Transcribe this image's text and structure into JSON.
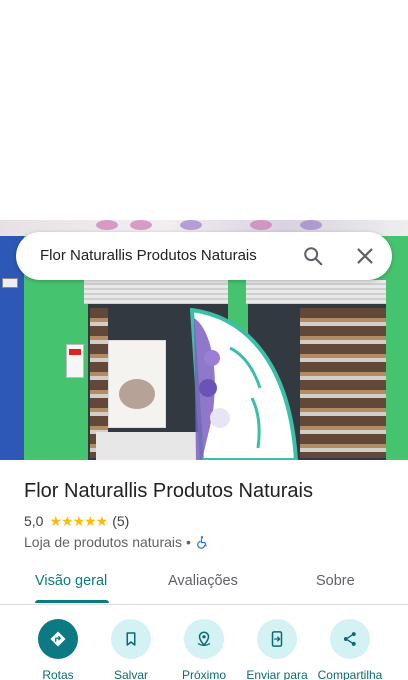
{
  "search": {
    "query": "Flor Naturallis Produtos Naturais"
  },
  "place": {
    "name": "Flor Naturallis Produtos Naturais",
    "rating": "5,0",
    "stars": "★★★★★",
    "review_count": "(5)",
    "category": "Loja de produtos naturais",
    "separator": "•"
  },
  "tabs": [
    {
      "label": "Visão geral",
      "active": true
    },
    {
      "label": "Avaliações",
      "active": false
    },
    {
      "label": "Sobre",
      "active": false
    }
  ],
  "actions": [
    {
      "label": "Rotas",
      "icon": "directions-icon"
    },
    {
      "label": "Salvar",
      "icon": "bookmark-icon"
    },
    {
      "label": "Próximo",
      "icon": "nearby-icon"
    },
    {
      "label": "Enviar para",
      "icon": "send-to-phone-icon"
    },
    {
      "label": "Compartilha",
      "icon": "share-icon"
    }
  ],
  "colors": {
    "accent": "#0b7a83",
    "action_bg": "#d4f1f4",
    "star": "#fbbc04",
    "storefront_green": "#46c36f"
  }
}
